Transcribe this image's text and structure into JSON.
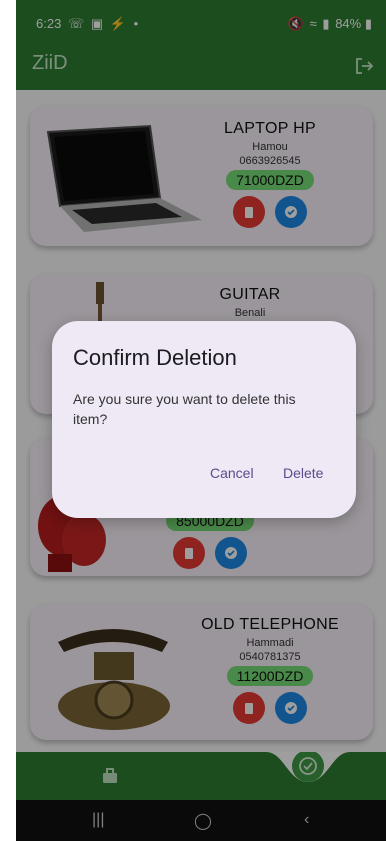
{
  "status_bar": {
    "time": "6:23",
    "battery": "84%"
  },
  "app_bar": {
    "title": "ZiiD"
  },
  "colors": {
    "primary": "#2e7d32",
    "price_badge": "#77dd77",
    "delete": "#e53935",
    "confirm": "#1e88e5",
    "dialog_bg": "#efe9f5",
    "dialog_action": "#5b4a8c"
  },
  "items": [
    {
      "name": "LAPTOP HP",
      "owner": "Hamou",
      "phone": "0663926545",
      "price": "71000DZD"
    },
    {
      "name": "GUITAR",
      "owner": "Benali"
    },
    {
      "price": "85000DZD"
    },
    {
      "name": "OLD TELEPHONE",
      "owner": "Hammadi",
      "phone": "0540781375",
      "price": "11200DZD"
    }
  ],
  "dialog": {
    "title": "Confirm Deletion",
    "message": "Are you sure you want to delete this item?",
    "cancel": "Cancel",
    "delete": "Delete"
  },
  "icons": [
    "whatsapp-icon",
    "gallery-icon",
    "flash-icon",
    "mute-icon",
    "wifi-icon",
    "signal-icon",
    "battery-icon",
    "logout-icon",
    "trash-icon",
    "check-icon",
    "inventory-icon",
    "add-check-icon",
    "recent-apps-icon",
    "home-icon",
    "back-icon"
  ]
}
